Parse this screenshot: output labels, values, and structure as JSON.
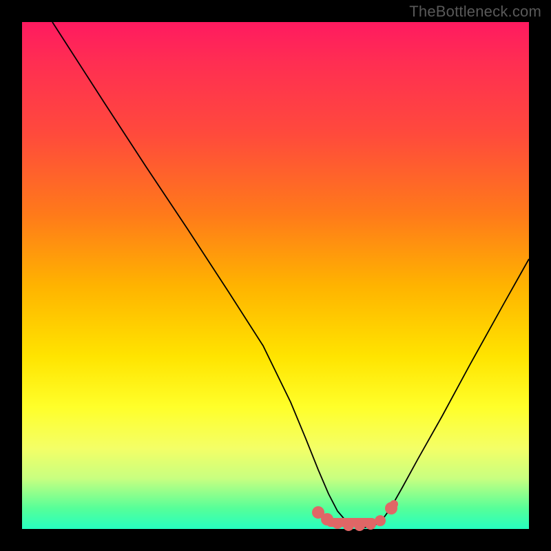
{
  "watermark": "TheBottleneck.com",
  "chart_data": {
    "type": "line",
    "title": "",
    "xlabel": "",
    "ylabel": "",
    "xlim": [
      0,
      100
    ],
    "ylim": [
      0,
      100
    ],
    "series": [
      {
        "name": "curve",
        "x": [
          6,
          10,
          15,
          20,
          25,
          30,
          35,
          40,
          45,
          50,
          53,
          55,
          57,
          60,
          63,
          66,
          68,
          70,
          72,
          75,
          80,
          85,
          90,
          95,
          100
        ],
        "y": [
          100,
          93,
          85,
          77,
          69,
          61,
          53,
          45,
          36,
          27,
          20,
          15,
          10,
          5,
          2,
          1,
          1,
          2,
          4,
          8,
          15,
          23,
          31,
          40,
          49
        ]
      }
    ],
    "highlight_region": {
      "name": "bottom-dots",
      "x": [
        55,
        57,
        59,
        61,
        63,
        65,
        67,
        69,
        71,
        73
      ],
      "y": [
        5,
        3,
        2,
        1.5,
        1,
        1,
        1,
        1.5,
        2.5,
        5
      ]
    },
    "colors": {
      "curve": "#000000",
      "highlight": "#e06666",
      "gradient_top": "#ff1a60",
      "gradient_bottom": "#26ffc0"
    }
  }
}
